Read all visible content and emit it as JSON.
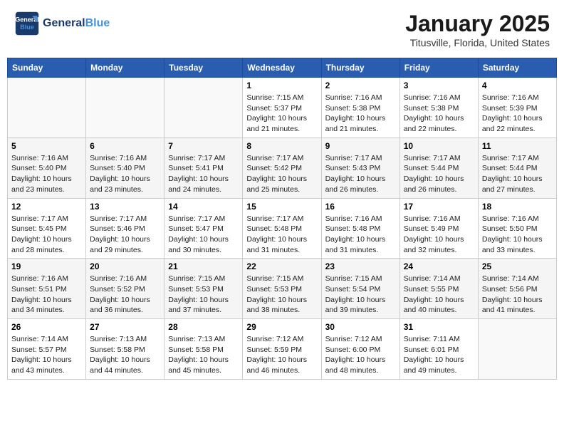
{
  "header": {
    "logo_line1": "General",
    "logo_line2": "Blue",
    "month": "January 2025",
    "location": "Titusville, Florida, United States"
  },
  "weekdays": [
    "Sunday",
    "Monday",
    "Tuesday",
    "Wednesday",
    "Thursday",
    "Friday",
    "Saturday"
  ],
  "weeks": [
    [
      {
        "day": "",
        "info": ""
      },
      {
        "day": "",
        "info": ""
      },
      {
        "day": "",
        "info": ""
      },
      {
        "day": "1",
        "info": "Sunrise: 7:15 AM\nSunset: 5:37 PM\nDaylight: 10 hours\nand 21 minutes."
      },
      {
        "day": "2",
        "info": "Sunrise: 7:16 AM\nSunset: 5:38 PM\nDaylight: 10 hours\nand 21 minutes."
      },
      {
        "day": "3",
        "info": "Sunrise: 7:16 AM\nSunset: 5:38 PM\nDaylight: 10 hours\nand 22 minutes."
      },
      {
        "day": "4",
        "info": "Sunrise: 7:16 AM\nSunset: 5:39 PM\nDaylight: 10 hours\nand 22 minutes."
      }
    ],
    [
      {
        "day": "5",
        "info": "Sunrise: 7:16 AM\nSunset: 5:40 PM\nDaylight: 10 hours\nand 23 minutes."
      },
      {
        "day": "6",
        "info": "Sunrise: 7:16 AM\nSunset: 5:40 PM\nDaylight: 10 hours\nand 23 minutes."
      },
      {
        "day": "7",
        "info": "Sunrise: 7:17 AM\nSunset: 5:41 PM\nDaylight: 10 hours\nand 24 minutes."
      },
      {
        "day": "8",
        "info": "Sunrise: 7:17 AM\nSunset: 5:42 PM\nDaylight: 10 hours\nand 25 minutes."
      },
      {
        "day": "9",
        "info": "Sunrise: 7:17 AM\nSunset: 5:43 PM\nDaylight: 10 hours\nand 26 minutes."
      },
      {
        "day": "10",
        "info": "Sunrise: 7:17 AM\nSunset: 5:44 PM\nDaylight: 10 hours\nand 26 minutes."
      },
      {
        "day": "11",
        "info": "Sunrise: 7:17 AM\nSunset: 5:44 PM\nDaylight: 10 hours\nand 27 minutes."
      }
    ],
    [
      {
        "day": "12",
        "info": "Sunrise: 7:17 AM\nSunset: 5:45 PM\nDaylight: 10 hours\nand 28 minutes."
      },
      {
        "day": "13",
        "info": "Sunrise: 7:17 AM\nSunset: 5:46 PM\nDaylight: 10 hours\nand 29 minutes."
      },
      {
        "day": "14",
        "info": "Sunrise: 7:17 AM\nSunset: 5:47 PM\nDaylight: 10 hours\nand 30 minutes."
      },
      {
        "day": "15",
        "info": "Sunrise: 7:17 AM\nSunset: 5:48 PM\nDaylight: 10 hours\nand 31 minutes."
      },
      {
        "day": "16",
        "info": "Sunrise: 7:16 AM\nSunset: 5:48 PM\nDaylight: 10 hours\nand 31 minutes."
      },
      {
        "day": "17",
        "info": "Sunrise: 7:16 AM\nSunset: 5:49 PM\nDaylight: 10 hours\nand 32 minutes."
      },
      {
        "day": "18",
        "info": "Sunrise: 7:16 AM\nSunset: 5:50 PM\nDaylight: 10 hours\nand 33 minutes."
      }
    ],
    [
      {
        "day": "19",
        "info": "Sunrise: 7:16 AM\nSunset: 5:51 PM\nDaylight: 10 hours\nand 34 minutes."
      },
      {
        "day": "20",
        "info": "Sunrise: 7:16 AM\nSunset: 5:52 PM\nDaylight: 10 hours\nand 36 minutes."
      },
      {
        "day": "21",
        "info": "Sunrise: 7:15 AM\nSunset: 5:53 PM\nDaylight: 10 hours\nand 37 minutes."
      },
      {
        "day": "22",
        "info": "Sunrise: 7:15 AM\nSunset: 5:53 PM\nDaylight: 10 hours\nand 38 minutes."
      },
      {
        "day": "23",
        "info": "Sunrise: 7:15 AM\nSunset: 5:54 PM\nDaylight: 10 hours\nand 39 minutes."
      },
      {
        "day": "24",
        "info": "Sunrise: 7:14 AM\nSunset: 5:55 PM\nDaylight: 10 hours\nand 40 minutes."
      },
      {
        "day": "25",
        "info": "Sunrise: 7:14 AM\nSunset: 5:56 PM\nDaylight: 10 hours\nand 41 minutes."
      }
    ],
    [
      {
        "day": "26",
        "info": "Sunrise: 7:14 AM\nSunset: 5:57 PM\nDaylight: 10 hours\nand 43 minutes."
      },
      {
        "day": "27",
        "info": "Sunrise: 7:13 AM\nSunset: 5:58 PM\nDaylight: 10 hours\nand 44 minutes."
      },
      {
        "day": "28",
        "info": "Sunrise: 7:13 AM\nSunset: 5:58 PM\nDaylight: 10 hours\nand 45 minutes."
      },
      {
        "day": "29",
        "info": "Sunrise: 7:12 AM\nSunset: 5:59 PM\nDaylight: 10 hours\nand 46 minutes."
      },
      {
        "day": "30",
        "info": "Sunrise: 7:12 AM\nSunset: 6:00 PM\nDaylight: 10 hours\nand 48 minutes."
      },
      {
        "day": "31",
        "info": "Sunrise: 7:11 AM\nSunset: 6:01 PM\nDaylight: 10 hours\nand 49 minutes."
      },
      {
        "day": "",
        "info": ""
      }
    ]
  ]
}
